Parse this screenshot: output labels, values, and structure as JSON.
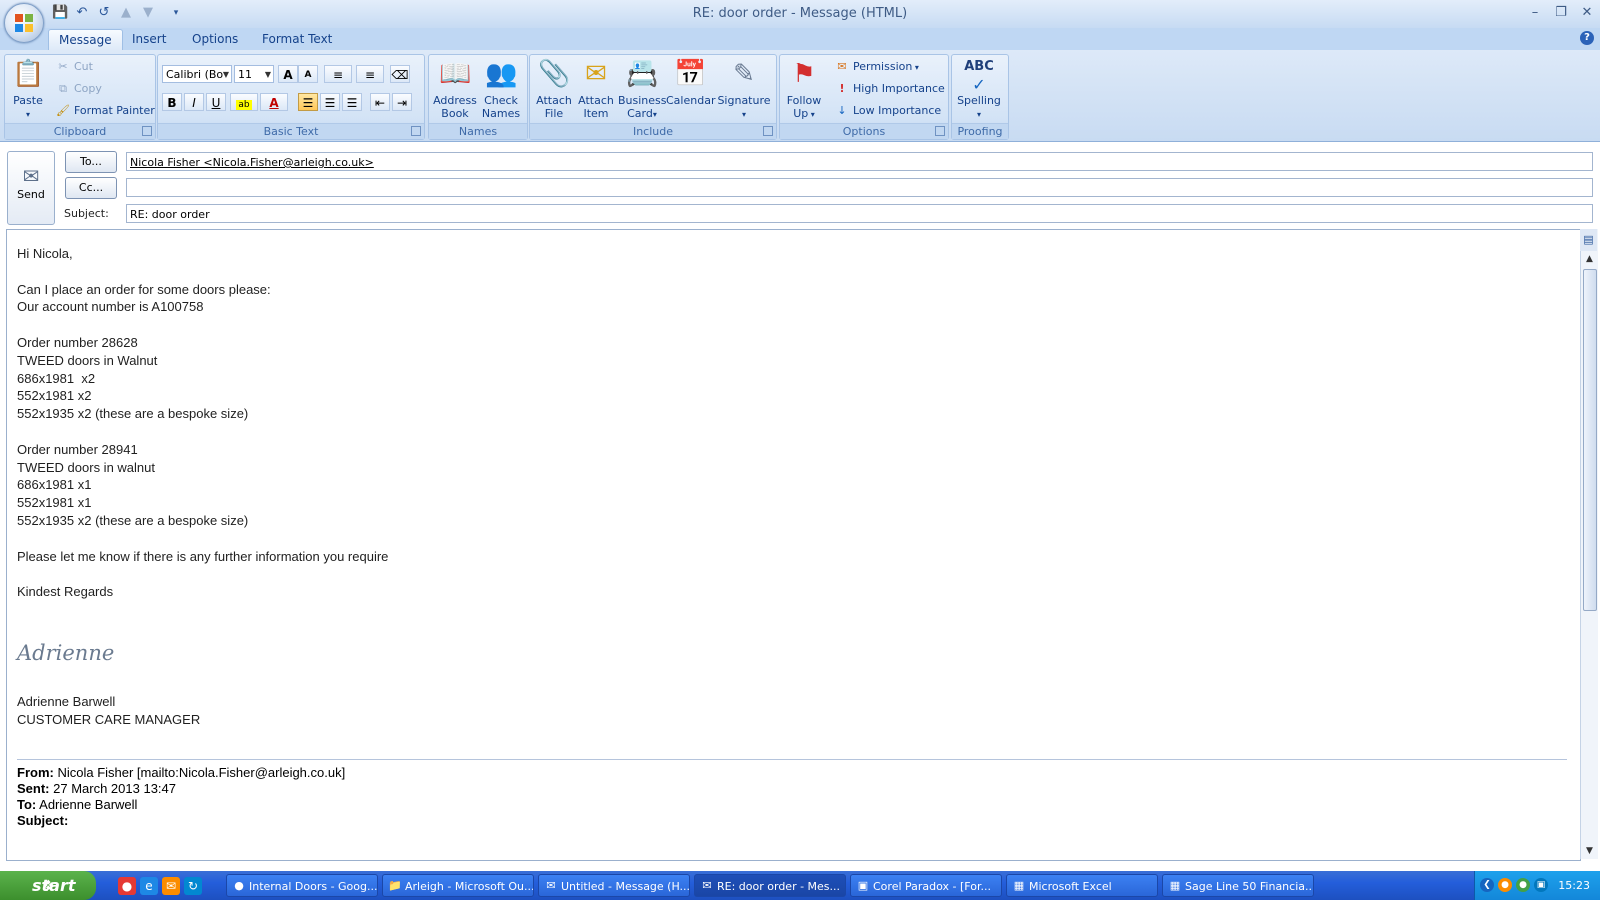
{
  "window": {
    "title": "RE: door order - Message (HTML)",
    "minimize": "–",
    "restore": "❐",
    "close": "✕"
  },
  "ribbon_tabs": [
    "Message",
    "Insert",
    "Options",
    "Format Text"
  ],
  "ribbon": {
    "clipboard": {
      "label": "Clipboard",
      "paste": "Paste",
      "cut": "Cut",
      "copy": "Copy",
      "format_painter": "Format Painter"
    },
    "basic_text": {
      "label": "Basic Text",
      "font": "Calibri (Bo",
      "size": "11",
      "grow_font": "A",
      "shrink_font": "A",
      "bold": "B",
      "italic": "I",
      "underline": "U",
      "font_color": "A"
    },
    "names": {
      "label": "Names",
      "address_book_1": "Address",
      "address_book_2": "Book",
      "check_names_1": "Check",
      "check_names_2": "Names"
    },
    "include": {
      "label": "Include",
      "attach_file_1": "Attach",
      "attach_file_2": "File",
      "attach_item_1": "Attach",
      "attach_item_2": "Item",
      "business_card_1": "Business",
      "business_card_2": "Card",
      "calendar": "Calendar",
      "signature": "Signature"
    },
    "options": {
      "label": "Options",
      "follow_up_1": "Follow",
      "follow_up_2": "Up",
      "permission": "Permission",
      "high_importance": "High Importance",
      "low_importance": "Low Importance"
    },
    "proofing": {
      "label": "Proofing",
      "spelling": "Spelling",
      "abc": "ABC"
    }
  },
  "header": {
    "send": "Send",
    "to_button": "To...",
    "cc_button": "Cc...",
    "subject_label": "Subject:",
    "to_value": "Nicola Fisher <Nicola.Fisher@arleigh.co.uk>",
    "cc_value": "",
    "subject_value": "RE: door order"
  },
  "body": {
    "lines": [
      "Hi Nicola,",
      "",
      "Can I place an order for some doors please:",
      "Our account number is A100758",
      "",
      "Order number 28628",
      "TWEED doors in Walnut",
      "686x1981  x2",
      "552x1981 x2",
      "552x1935 x2 (these are a bespoke size)",
      "",
      "Order number 28941",
      "TWEED doors in walnut",
      "686x1981 x1",
      "552x1981 x1",
      "552x1935 x2 (these are a bespoke size)",
      "",
      "Please let me know if there is any further information you require",
      "",
      "Kindest Regards"
    ],
    "signature_script": "Adrienne",
    "sender_name": "Adrienne Barwell",
    "sender_title": "CUSTOMER CARE MANAGER",
    "quoted": {
      "from_label": "From:",
      "from_value": "Nicola Fisher [mailto:Nicola.Fisher@arleigh.co.uk]",
      "sent_label": "Sent:",
      "sent_value": "27 March 2013 13:47",
      "to_label": "To:",
      "to_value": "Adrienne Barwell",
      "subject_label": "Subject:"
    }
  },
  "taskbar": {
    "start": "start",
    "tasks": [
      "Internal Doors - Goog...",
      "Arleigh - Microsoft Ou...",
      "Untitled - Message (H...",
      "RE: door order - Mes...",
      "Corel Paradox - [For...",
      "Microsoft Excel",
      "Sage Line 50 Financia..."
    ],
    "clock": "15:23"
  }
}
